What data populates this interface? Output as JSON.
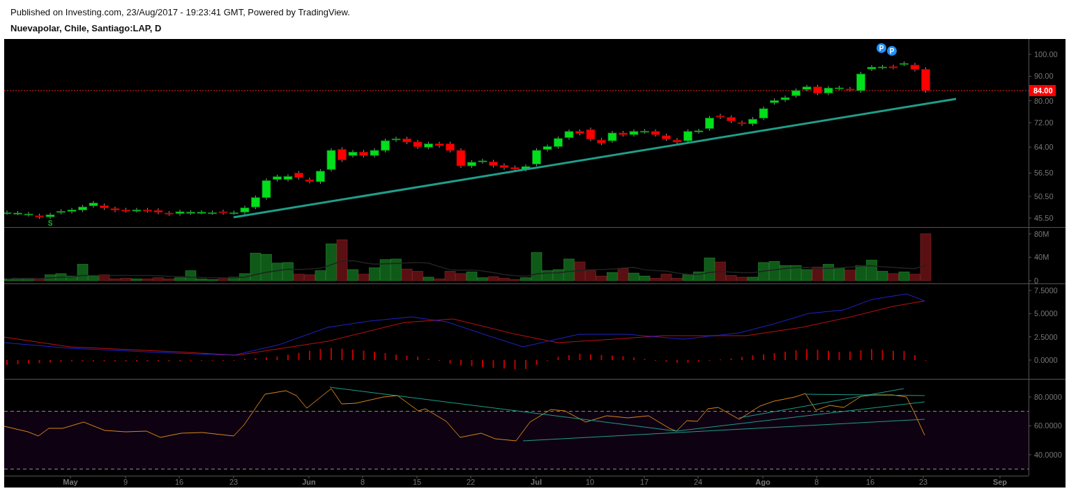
{
  "header": {
    "published": "Published on Investing.com, 23/Aug/2017 - 19:23:41 GMT, Powered by TradingView.",
    "title": "Nuevapolar, Chile, Santiago:LAP, D"
  },
  "price_panel": {
    "axis_labels": [
      "100.00",
      "90.00",
      "80.00",
      "72.00",
      "64.00",
      "56.50",
      "50.50",
      "45.50"
    ],
    "last_price": "84.00",
    "event_markers": [
      "P",
      "P"
    ],
    "split_marker": "S"
  },
  "volume_panel": {
    "axis_labels": [
      "80M",
      "40M",
      "0"
    ]
  },
  "macd_panel": {
    "axis_labels": [
      "7.5000",
      "5.0000",
      "2.5000",
      "0.0000"
    ]
  },
  "rsi_panel": {
    "axis_labels": [
      "80.0000",
      "60.0000",
      "40.0000"
    ]
  },
  "time_axis": {
    "labels": [
      "May",
      "9",
      "16",
      "23",
      "Jun",
      "8",
      "15",
      "22",
      "Jul",
      "10",
      "17",
      "24",
      "Ago",
      "8",
      "16",
      "23",
      "Sep"
    ]
  }
}
